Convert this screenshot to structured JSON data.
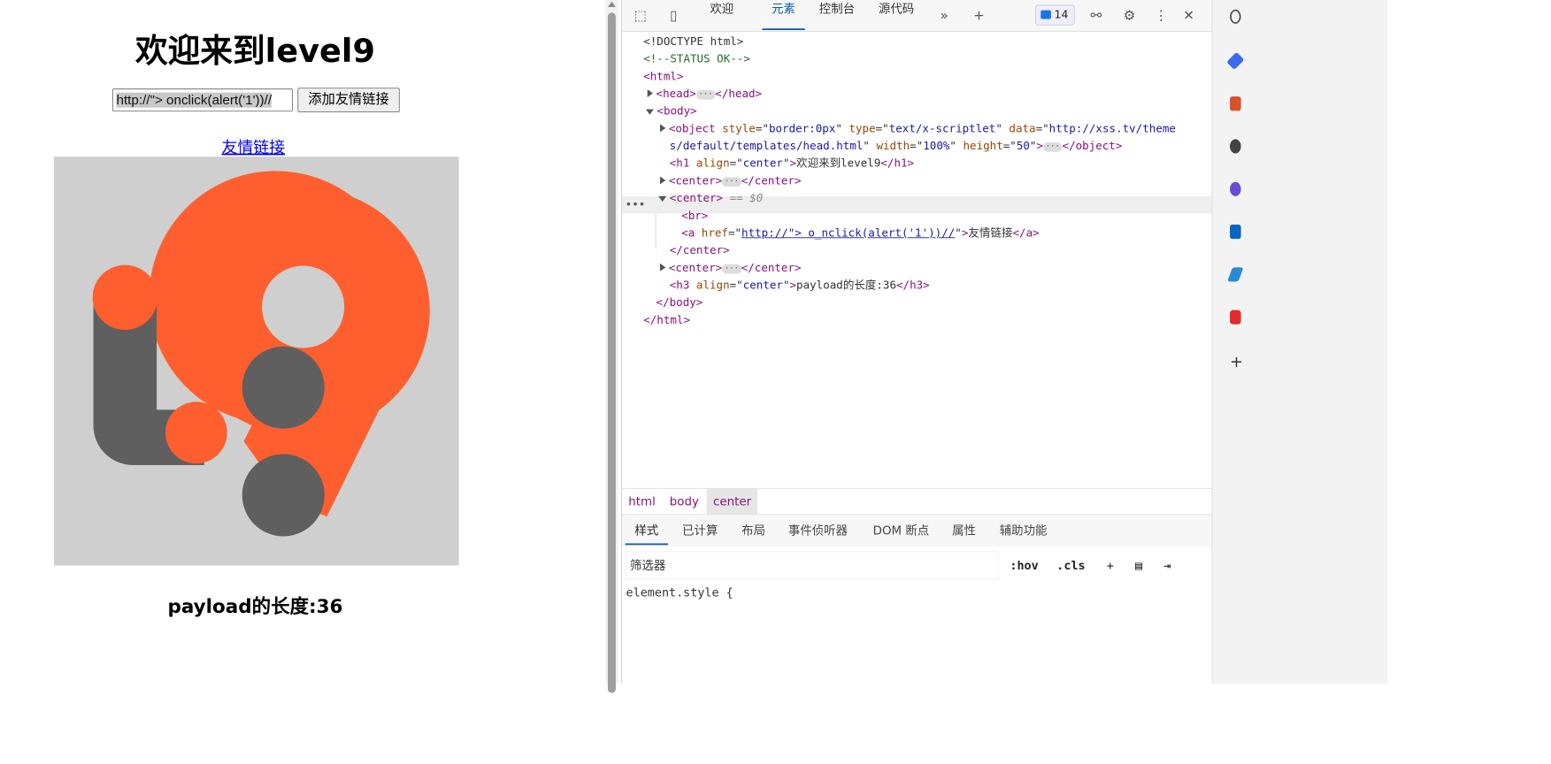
{
  "page": {
    "heading": "欢迎来到level9",
    "input_value": "http://\"> onclick(alert('1'))//",
    "submit_label": "添加友情链接",
    "link_text": "友情链接",
    "payload_text": "payload的长度:36"
  },
  "devtools": {
    "tabs": [
      "欢迎",
      "元素",
      "控制台",
      "源代码"
    ],
    "active_tab": "元素",
    "issues_count": "14",
    "dom": {
      "doctype": "<!DOCTYPE html>",
      "comment": "<!--STATUS OK-->",
      "object_style": "border:0px",
      "object_type": "text/x-scriptlet",
      "object_data_1": "http://xss.tv/theme",
      "object_data_2": "s/default/templates/head.html",
      "object_width": "100%",
      "object_height": "50",
      "h1_align": "center",
      "h1_text": "欢迎来到level9",
      "selected_marker": "== $0",
      "a_href": "http://\"> o_nclick(alert('1'))//",
      "a_text": "友情链接",
      "h3_align": "center",
      "h3_text": "payload的长度:36"
    },
    "breadcrumb": [
      "html",
      "body",
      "center"
    ],
    "style_tabs": [
      "样式",
      "已计算",
      "布局",
      "事件侦听器",
      "DOM 断点",
      "属性",
      "辅助功能"
    ],
    "filter_placeholder": "筛选器",
    "hov": ":hov",
    "cls": ".cls",
    "element_style": "element.style {"
  }
}
